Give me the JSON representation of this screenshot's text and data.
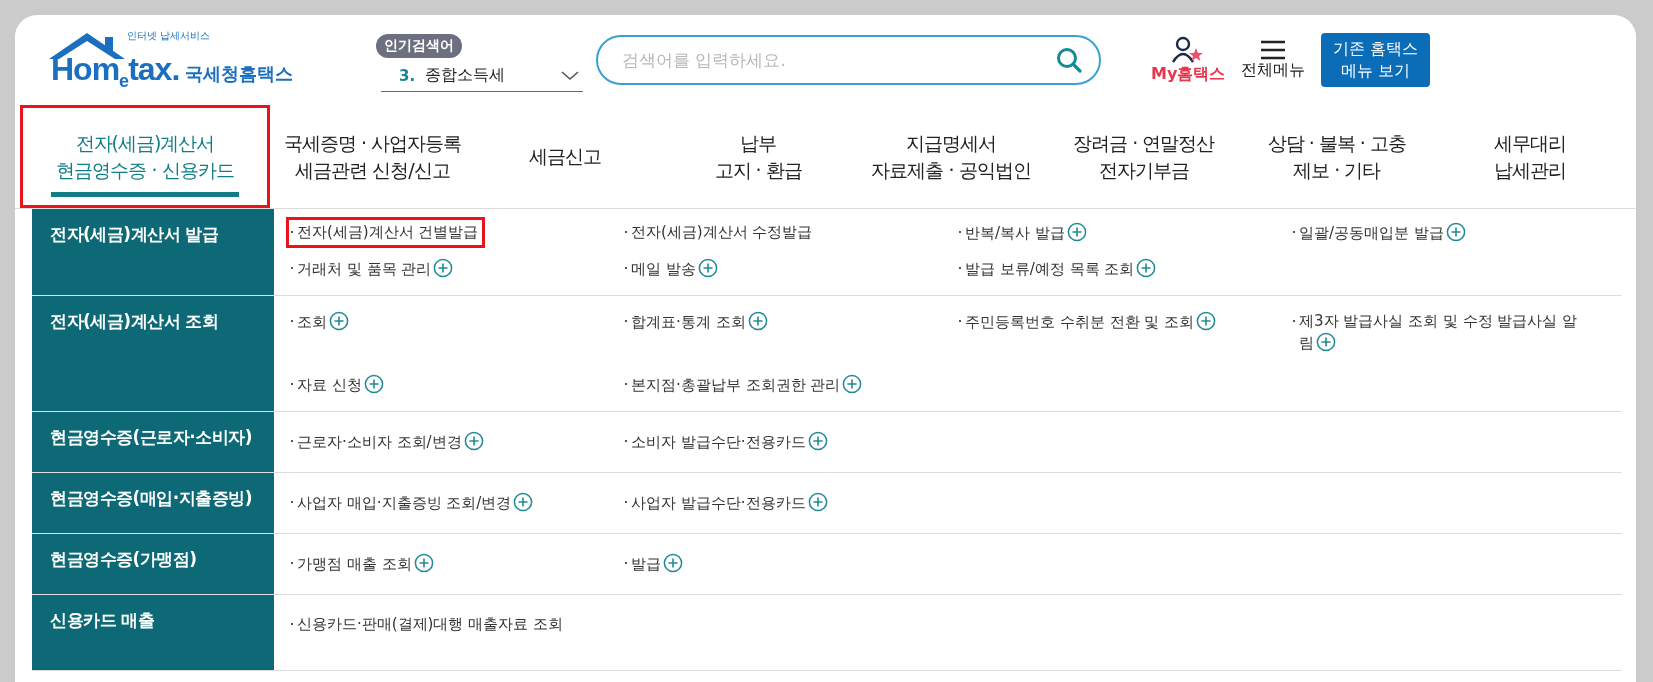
{
  "logo": {
    "tagline": "인터넷 납세서비스",
    "wordmark": "Hom$_{e}$tax.",
    "name": "국세청홈택스"
  },
  "popular": {
    "badge": "인기검색어",
    "rank": "3.",
    "term": "종합소득세"
  },
  "search": {
    "placeholder": "검색어를 입력하세요."
  },
  "my_hometax": "My홈택스",
  "all_menu": "전체메뉴",
  "classic_button": [
    "기존 홈택스",
    "메뉴 보기"
  ],
  "tabs": [
    {
      "lines": [
        "전자(세금)계산서",
        "현금영수증 · 신용카드"
      ],
      "selected": true,
      "highlighted": true
    },
    {
      "lines": [
        "국세증명 · 사업자등록",
        "세금관련 신청/신고"
      ],
      "selected": false,
      "highlighted": false
    },
    {
      "lines": [
        "세금신고"
      ],
      "selected": false,
      "highlighted": false
    },
    {
      "lines": [
        "납부",
        "고지 · 환급"
      ],
      "selected": false,
      "highlighted": false
    },
    {
      "lines": [
        "지급명세서",
        "자료제출 · 공익법인"
      ],
      "selected": false,
      "highlighted": false
    },
    {
      "lines": [
        "장려금 · 연말정산",
        "전자기부금"
      ],
      "selected": false,
      "highlighted": false
    },
    {
      "lines": [
        "상담 · 불복 · 고충",
        "제보 · 기타"
      ],
      "selected": false,
      "highlighted": false
    },
    {
      "lines": [
        "세무대리",
        "납세관리"
      ],
      "selected": false,
      "highlighted": false
    }
  ],
  "menu": [
    {
      "heading": "전자(세금)계산서 발급",
      "items": [
        {
          "label": "전자(세금)계산서 건별발급",
          "plus": false,
          "highlighted": true
        },
        {
          "label": "전자(세금)계산서 수정발급",
          "plus": false,
          "highlighted": false
        },
        {
          "label": "반복/복사 발급",
          "plus": true,
          "highlighted": false
        },
        {
          "label": "일괄/공동매입분 발급",
          "plus": true,
          "highlighted": false
        },
        {
          "label": "거래처 및 품목 관리",
          "plus": true,
          "highlighted": false
        },
        {
          "label": "메일 발송",
          "plus": true,
          "highlighted": false
        },
        {
          "label": "발급 보류/예정 목록 조회",
          "plus": true,
          "highlighted": false
        }
      ]
    },
    {
      "heading": "전자(세금)계산서 조회",
      "items": [
        {
          "label": "조회",
          "plus": true,
          "highlighted": false
        },
        {
          "label": "합계표·통계 조회",
          "plus": true,
          "highlighted": false
        },
        {
          "label": "주민등록번호 수취분 전환 및 조회",
          "plus": true,
          "highlighted": false
        },
        {
          "label": "제3자 발급사실 조회 및 수정 발급사실 알림",
          "plus": true,
          "highlighted": false
        },
        {
          "label": "자료 신청",
          "plus": true,
          "highlighted": false
        },
        {
          "label": "본지점·총괄납부 조회권한 관리",
          "plus": true,
          "highlighted": false
        }
      ]
    },
    {
      "heading": "현금영수증(근로자·소비자)",
      "items": [
        {
          "label": "근로자·소비자 조회/변경",
          "plus": true,
          "highlighted": false
        },
        {
          "label": "소비자 발급수단·전용카드",
          "plus": true,
          "highlighted": false
        }
      ]
    },
    {
      "heading": "현금영수증(매입·지출증빙)",
      "items": [
        {
          "label": "사업자 매입·지출증빙 조회/변경",
          "plus": true,
          "highlighted": false
        },
        {
          "label": "사업자 발급수단·전용카드",
          "plus": true,
          "highlighted": false
        }
      ]
    },
    {
      "heading": "현금영수증(가맹점)",
      "items": [
        {
          "label": "가맹점 매출 조회",
          "plus": true,
          "highlighted": false
        },
        {
          "label": "발급",
          "plus": true,
          "highlighted": false
        }
      ]
    },
    {
      "heading": "신용카드 매출",
      "items": [
        {
          "label": "신용카드·판매(결제)대행 매출자료 조회",
          "plus": false,
          "highlighted": false
        }
      ]
    }
  ]
}
